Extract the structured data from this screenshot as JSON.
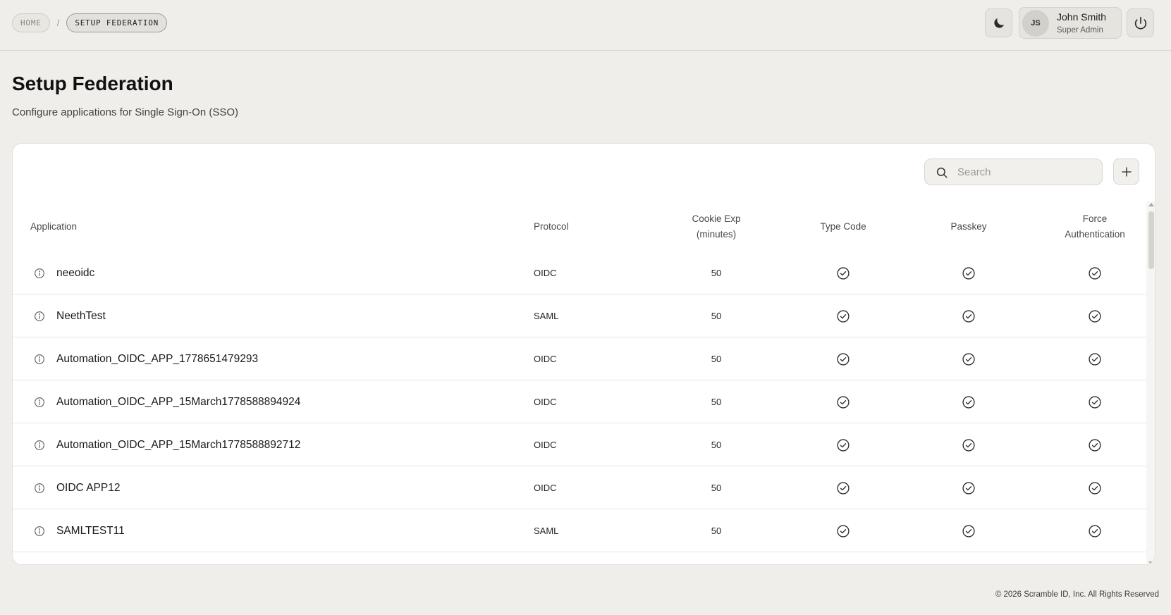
{
  "breadcrumb": {
    "home": "HOME",
    "separator": "/",
    "current": "SETUP FEDERATION"
  },
  "header": {
    "theme_icon": "moon-icon",
    "user": {
      "initials": "JS",
      "name": "John Smith",
      "role": "Super Admin"
    },
    "logout_icon": "power-icon"
  },
  "page": {
    "title": "Setup Federation",
    "subtitle": "Configure applications for Single Sign-On (SSO)"
  },
  "toolbar": {
    "search_placeholder": "Search",
    "add_icon": "plus-icon"
  },
  "table": {
    "columns": {
      "application": "Application",
      "protocol": "Protocol",
      "cookie_exp_line1": "Cookie Exp",
      "cookie_exp_line2": "(minutes)",
      "type_code": "Type Code",
      "passkey": "Passkey",
      "force_auth_line1": "Force",
      "force_auth_line2": "Authentication"
    },
    "rows": [
      {
        "name": "neeoidc",
        "protocol": "OIDC",
        "cookie_exp": "50",
        "type_code": true,
        "passkey": true,
        "force_auth": true
      },
      {
        "name": "NeethTest",
        "protocol": "SAML",
        "cookie_exp": "50",
        "type_code": true,
        "passkey": true,
        "force_auth": true
      },
      {
        "name": "Automation_OIDC_APP_1778651479293",
        "protocol": "OIDC",
        "cookie_exp": "50",
        "type_code": true,
        "passkey": true,
        "force_auth": true
      },
      {
        "name": "Automation_OIDC_APP_15March1778588894924",
        "protocol": "OIDC",
        "cookie_exp": "50",
        "type_code": true,
        "passkey": true,
        "force_auth": true
      },
      {
        "name": "Automation_OIDC_APP_15March1778588892712",
        "protocol": "OIDC",
        "cookie_exp": "50",
        "type_code": true,
        "passkey": true,
        "force_auth": true
      },
      {
        "name": "OIDC APP12",
        "protocol": "OIDC",
        "cookie_exp": "50",
        "type_code": true,
        "passkey": true,
        "force_auth": true
      },
      {
        "name": "SAMLTEST11",
        "protocol": "SAML",
        "cookie_exp": "50",
        "type_code": true,
        "passkey": true,
        "force_auth": true
      }
    ]
  },
  "footer": {
    "copyright": "© 2026 Scramble ID, Inc. All Rights Reserved"
  }
}
